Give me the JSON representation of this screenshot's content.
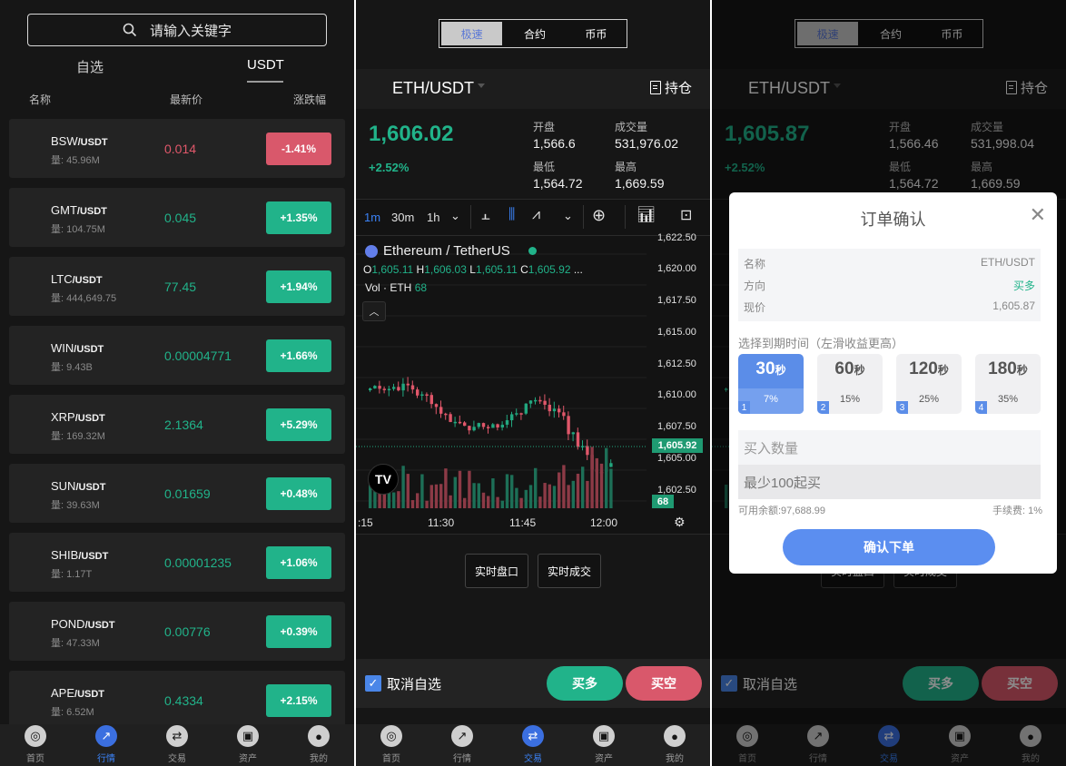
{
  "market": {
    "search_placeholder": "请输入关键字",
    "tabs": [
      "自选",
      "USDT"
    ],
    "col_name": "名称",
    "col_price": "最新价",
    "col_change": "涨跌幅",
    "rows": [
      {
        "base": "BSW",
        "quote": "/USDT",
        "vol": "量: 45.96M",
        "price": "0.014",
        "change": "-1.41%",
        "dir": "down"
      },
      {
        "base": "GMT",
        "quote": "/USDT",
        "vol": "量: 104.75M",
        "price": "0.045",
        "change": "+1.35%",
        "dir": "up"
      },
      {
        "base": "LTC",
        "quote": "/USDT",
        "vol": "量: 444,649.75",
        "price": "77.45",
        "change": "+1.94%",
        "dir": "up"
      },
      {
        "base": "WIN",
        "quote": "/USDT",
        "vol": "量: 9.43B",
        "price": "0.00004771",
        "change": "+1.66%",
        "dir": "up"
      },
      {
        "base": "XRP",
        "quote": "/USDT",
        "vol": "量: 169.32M",
        "price": "2.1364",
        "change": "+5.29%",
        "dir": "up"
      },
      {
        "base": "SUN",
        "quote": "/USDT",
        "vol": "量: 39.63M",
        "price": "0.01659",
        "change": "+0.48%",
        "dir": "up"
      },
      {
        "base": "SHIB",
        "quote": "/USDT",
        "vol": "量: 1.17T",
        "price": "0.00001235",
        "change": "+1.06%",
        "dir": "up"
      },
      {
        "base": "POND",
        "quote": "/USDT",
        "vol": "量: 47.33M",
        "price": "0.00776",
        "change": "+0.39%",
        "dir": "up"
      },
      {
        "base": "APE",
        "quote": "/USDT",
        "vol": "量: 6.52M",
        "price": "0.4334",
        "change": "+2.15%",
        "dir": "up"
      }
    ]
  },
  "nav": {
    "items": [
      "首页",
      "行情",
      "交易",
      "资产",
      "我的"
    ]
  },
  "trade": {
    "segments": [
      "极速",
      "合约",
      "币币"
    ],
    "pair": "ETH/USDT",
    "holdings": "持仓",
    "price": "1,606.02",
    "pct": "+2.52%",
    "open_lbl": "开盘",
    "open": "1,566.6",
    "vol_lbl": "成交量",
    "vol": "531,976.02",
    "low_lbl": "最低",
    "low": "1,564.72",
    "high_lbl": "最高",
    "high": "1,669.59",
    "toolbar": [
      "1m",
      "30m",
      "1h"
    ],
    "chart_title": "Ethereum / TetherUS",
    "ohlc": {
      "o_lbl": "O",
      "o": "1,605.11",
      "h_lbl": "H",
      "h": "1,606.03",
      "l_lbl": "L",
      "l": "1,605.11",
      "c_lbl": "C",
      "c": "1,605.92",
      "more": "..."
    },
    "vol_legend": "Vol · ETH",
    "vol_value": "68",
    "last_price_tag": "1,605.92",
    "vol_tag": "68",
    "yticks": [
      "1,622.50",
      "1,620.00",
      "1,617.50",
      "1,615.00",
      "1,612.50",
      "1,610.00",
      "1,607.50",
      "1,605.00",
      "1,602.50"
    ],
    "xticks": [
      ":15",
      "11:30",
      "11:45",
      "12:00"
    ],
    "btn_orderbook": "实时盘口",
    "btn_trades": "实时成交",
    "cancel_fav": "取消自选",
    "buy_long": "买多",
    "buy_short": "买空"
  },
  "trade3": {
    "price": "1,605.87",
    "pct": "+2.52%",
    "open": "1,566.46",
    "vol": "531,998.04",
    "low": "1,564.72",
    "high": "1,669.59"
  },
  "modal": {
    "title": "订单确认",
    "name_lbl": "名称",
    "name": "ETH/USDT",
    "dir_lbl": "方向",
    "dir": "买多",
    "price_lbl": "现价",
    "price": "1,605.87",
    "expiry_lbl": "选择到期时间（左滑收益更高）",
    "options": [
      {
        "sec": "30",
        "unit": "秒",
        "idx": "1",
        "pct": "7%"
      },
      {
        "sec": "60",
        "unit": "秒",
        "idx": "2",
        "pct": "15%"
      },
      {
        "sec": "120",
        "unit": "秒",
        "idx": "3",
        "pct": "25%"
      },
      {
        "sec": "180",
        "unit": "秒",
        "idx": "4",
        "pct": "35%"
      }
    ],
    "qty_lbl": "买入数量",
    "qty_placeholder": "最少100起买",
    "balance": "可用余额:97,688.99",
    "fee": "手续费: 1%",
    "confirm": "确认下单"
  },
  "colors": {
    "up": "#21b38a",
    "down": "#d9586b",
    "accent": "#3b82f6"
  }
}
